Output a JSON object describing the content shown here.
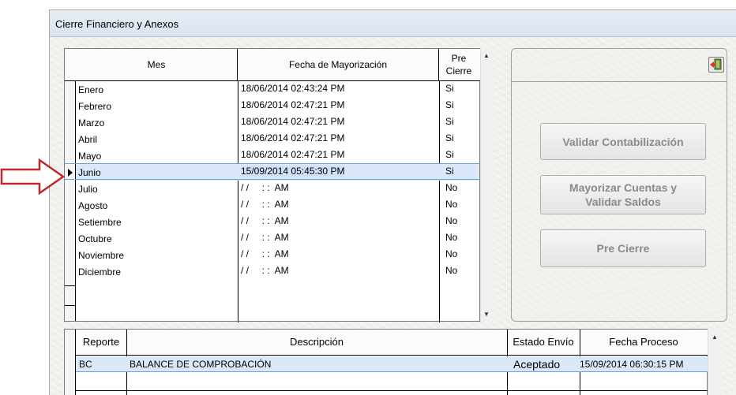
{
  "window": {
    "title": "Cierre Financiero y Anexos"
  },
  "months_grid": {
    "headers": {
      "mes": "Mes",
      "fecha": "Fecha de Mayorización",
      "pre_line1": "Pre",
      "pre_line2": "Cierre"
    },
    "rows": [
      {
        "mes": "Enero",
        "fecha": "18/06/2014 02:43:24 PM",
        "pre": "Si"
      },
      {
        "mes": "Febrero",
        "fecha": "18/06/2014 02:47:21 PM",
        "pre": "Si"
      },
      {
        "mes": "Marzo",
        "fecha": "18/06/2014 02:47:21 PM",
        "pre": "Si"
      },
      {
        "mes": "Abril",
        "fecha": "18/06/2014 02:47:21 PM",
        "pre": "Si"
      },
      {
        "mes": "Mayo",
        "fecha": "18/06/2014 02:47:21 PM",
        "pre": "Si"
      },
      {
        "mes": "Junio",
        "fecha": "15/09/2014 05:45:30 PM",
        "pre": "Si"
      },
      {
        "mes": "Julio",
        "fecha": "/ /     : :  AM",
        "pre": "No"
      },
      {
        "mes": "Agosto",
        "fecha": "/ /     : :  AM",
        "pre": "No"
      },
      {
        "mes": "Setiembre",
        "fecha": "/ /     : :  AM",
        "pre": "No"
      },
      {
        "mes": "Octubre",
        "fecha": "/ /     : :  AM",
        "pre": "No"
      },
      {
        "mes": "Noviembre",
        "fecha": "/ /     : :  AM",
        "pre": "No"
      },
      {
        "mes": "Diciembre",
        "fecha": "/ /     : :  AM",
        "pre": "No"
      }
    ],
    "selected_index": 5
  },
  "actions": {
    "validar": "Validar Contabilización",
    "mayorizar_line1": "Mayorizar Cuentas y",
    "mayorizar_line2": "Validar Saldos",
    "precierre": "Pre Cierre"
  },
  "reports_grid": {
    "headers": {
      "reporte": "Reporte",
      "descripcion": "Descripción",
      "estado": "Estado Envío",
      "fecha": "Fecha Proceso"
    },
    "rows": [
      {
        "reporte": "BC",
        "descripcion": "BALANCE DE COMPROBACIÓN",
        "estado": "Aceptado",
        "fecha": "15/09/2014  06:30:15 PM"
      }
    ]
  },
  "colors": {
    "annotation_arrow": "#c0282d",
    "selection": "#dbe8f9"
  },
  "icons": {
    "exit": "exit-door-icon",
    "row_pointer": "row-pointer-icon"
  }
}
